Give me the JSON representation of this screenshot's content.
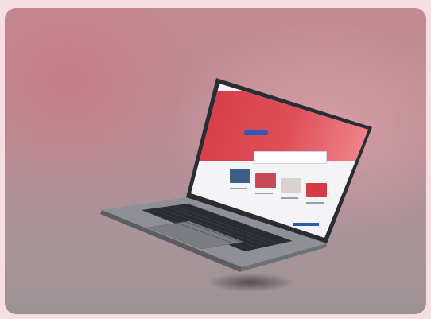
{
  "scene": {
    "description_color_background": "#f6dde2",
    "description_color_frame": "#b98d95"
  },
  "website": {
    "hero_title": "",
    "brand_color": "#d43b45",
    "button_color": "#2a5db8"
  }
}
